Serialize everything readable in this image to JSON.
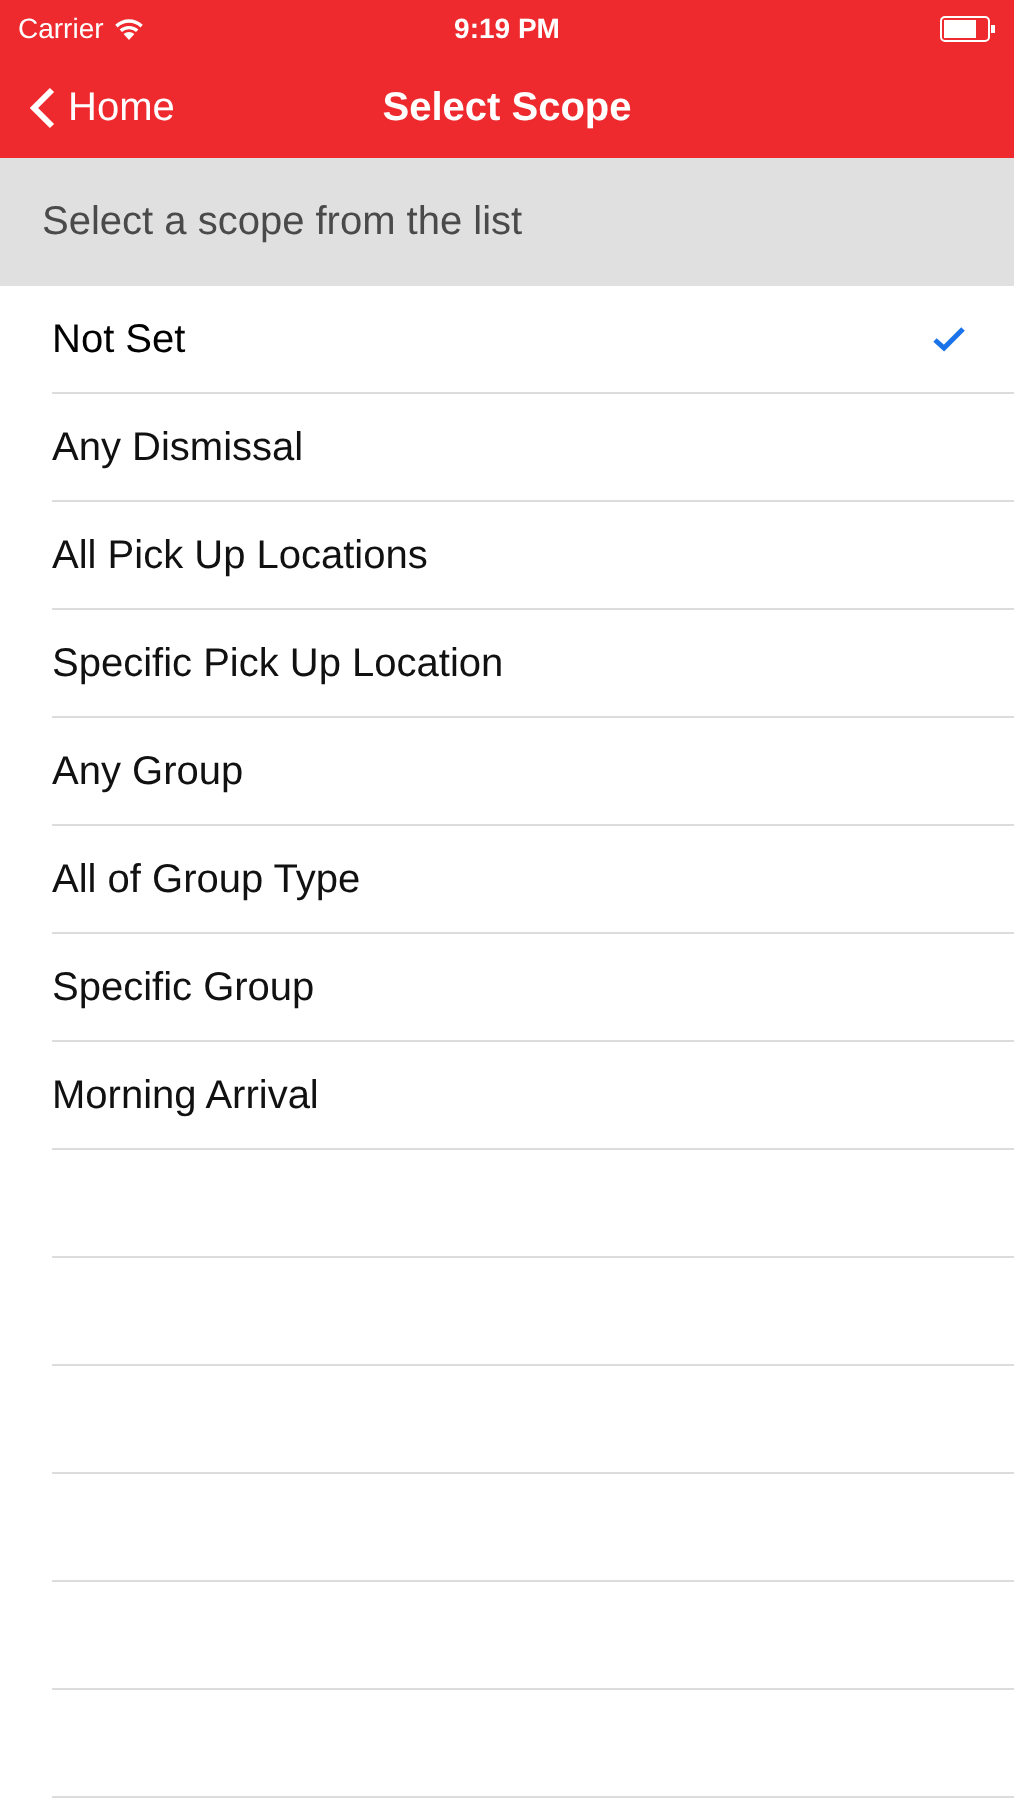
{
  "status_bar": {
    "carrier": "Carrier",
    "time": "9:19 PM"
  },
  "nav": {
    "back": "Home",
    "title": "Select Scope"
  },
  "section_header": "Select a scope from the list",
  "options": [
    {
      "label": "Not Set",
      "selected": true
    },
    {
      "label": "Any Dismissal",
      "selected": false
    },
    {
      "label": "All Pick Up Locations",
      "selected": false
    },
    {
      "label": "Specific Pick Up Location",
      "selected": false
    },
    {
      "label": "Any Group",
      "selected": false
    },
    {
      "label": "All of Group Type",
      "selected": false
    },
    {
      "label": "Specific Group",
      "selected": false
    },
    {
      "label": "Morning Arrival",
      "selected": false
    }
  ]
}
